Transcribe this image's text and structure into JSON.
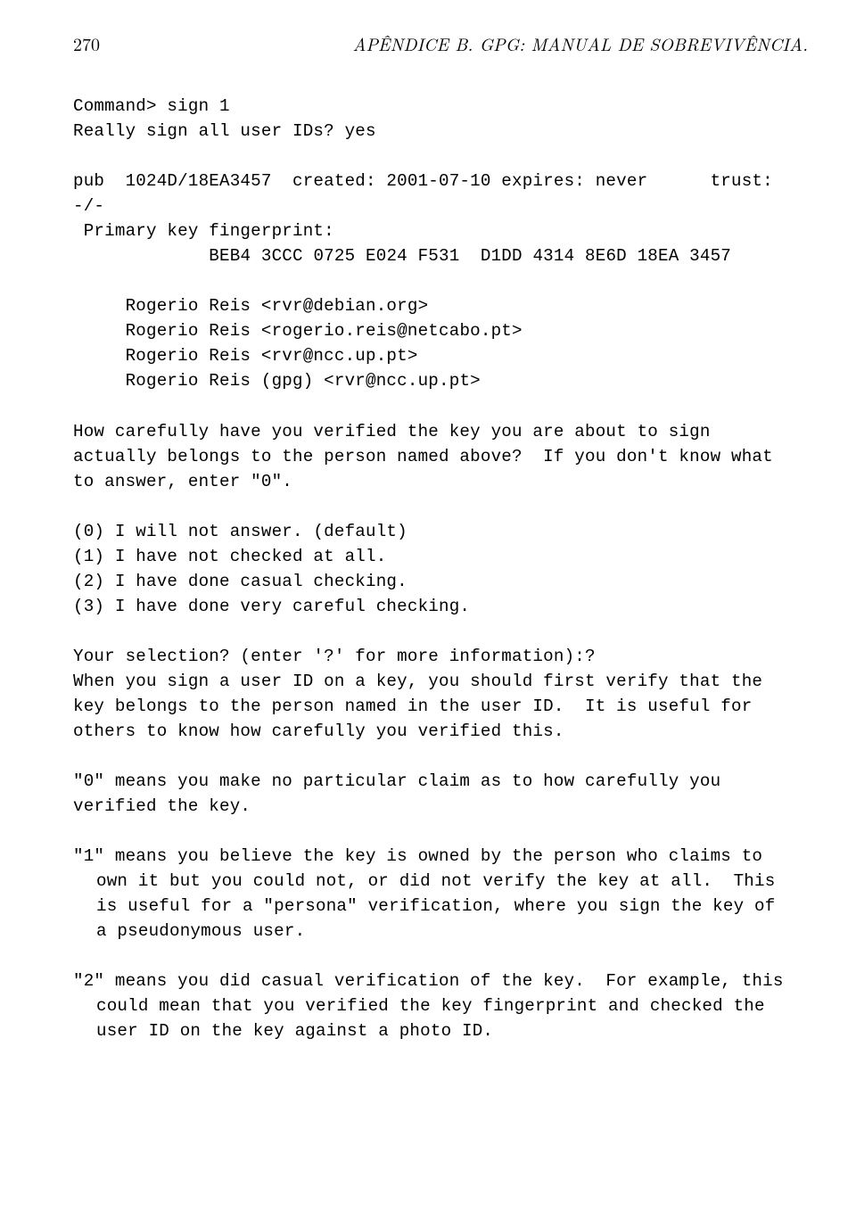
{
  "header": {
    "page_number": "270",
    "title": "APÊNDICE B. GPG: MANUAL DE SOBREVIVÊNCIA."
  },
  "p1": "Command> sign 1\nReally sign all user IDs? yes",
  "p2": "pub  1024D/18EA3457  created: 2001-07-10 expires: never      trust: -/-\n Primary key fingerprint:\n             BEB4 3CCC 0725 E024 F531  D1DD 4314 8E6D 18EA 3457",
  "p3": "     Rogerio Reis <rvr@debian.org>\n     Rogerio Reis <rogerio.reis@netcabo.pt>\n     Rogerio Reis <rvr@ncc.up.pt>\n     Rogerio Reis (gpg) <rvr@ncc.up.pt>",
  "p4": "How carefully have you verified the key you are about to sign\nactually belongs to the person named above?  If you don't know what\nto answer, enter \"0\".",
  "p5": "(0) I will not answer. (default)\n(1) I have not checked at all.\n(2) I have done casual checking.\n(3) I have done very careful checking.",
  "p6": "Your selection? (enter '?' for more information):?\nWhen you sign a user ID on a key, you should first verify that the\nkey belongs to the person named in the user ID.  It is useful for\nothers to know how carefully you verified this.",
  "p7": "\"0\" means you make no particular claim as to how carefully you\nverified the key.",
  "p8_first": "\"1\" means you believe the key is owned by the person who claims to",
  "p8_rest": "own it but you could not, or did not verify the key at all.  This\nis useful for a \"persona\" verification, where you sign the key of\na pseudonymous user.",
  "p9_first": "\"2\" means you did casual verification of the key.  For example, this",
  "p9_rest": "could mean that you verified the key fingerprint and checked the\nuser ID on the key against a photo ID."
}
